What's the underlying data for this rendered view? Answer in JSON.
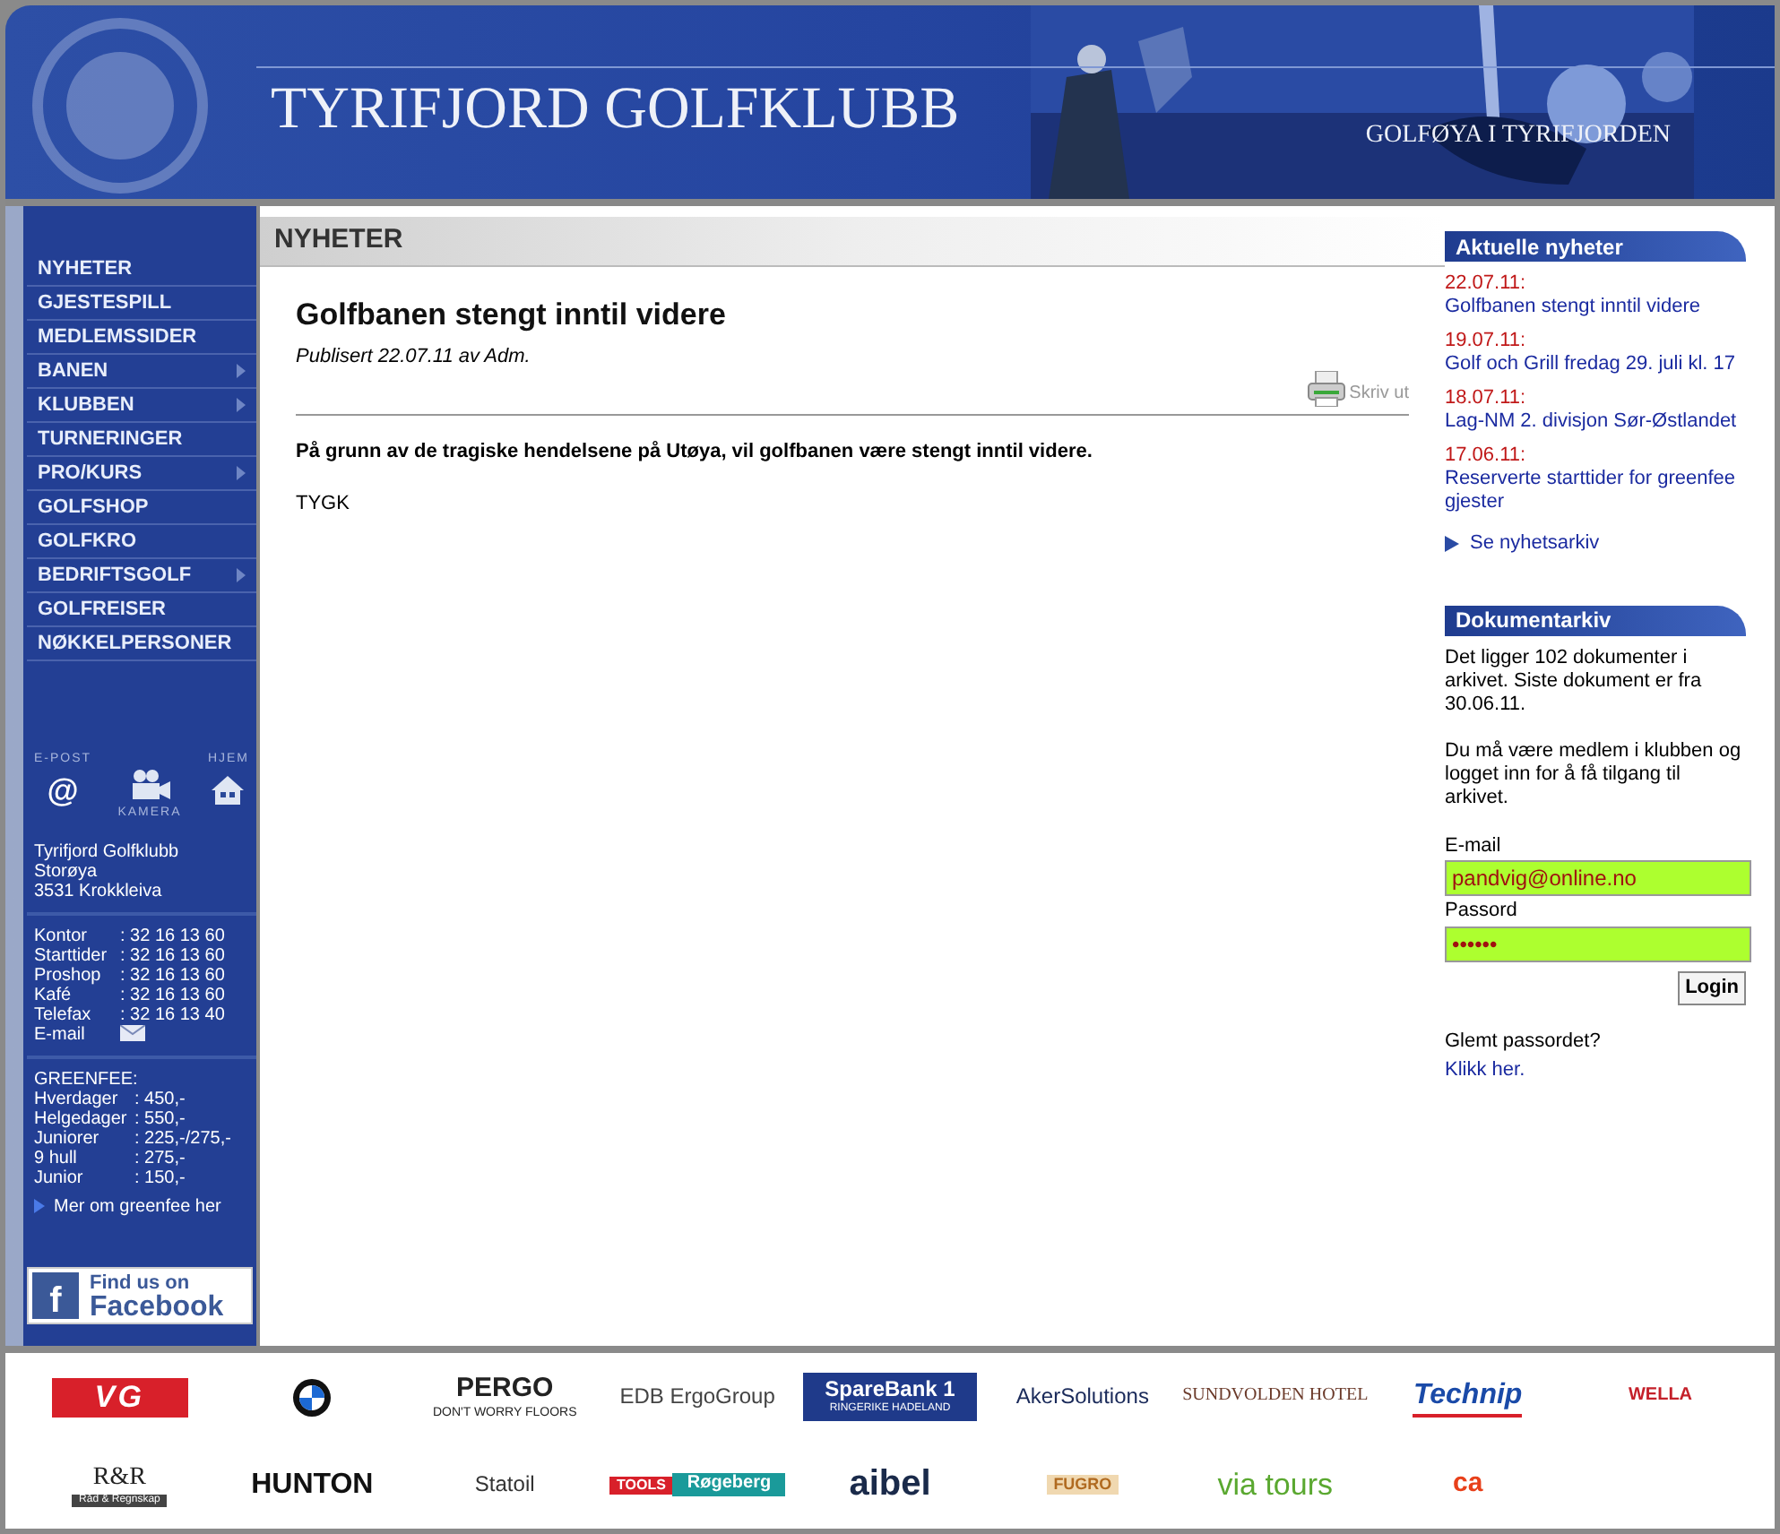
{
  "header": {
    "title": "TYRIFJORD GOLFKLUBB",
    "tagline": "GOLFØYA I TYRIFJORDEN"
  },
  "menu": [
    {
      "label": "NYHETER",
      "has_submenu": false
    },
    {
      "label": "GJESTESPILL",
      "has_submenu": false
    },
    {
      "label": "MEDLEMSSIDER",
      "has_submenu": false
    },
    {
      "label": "BANEN",
      "has_submenu": true
    },
    {
      "label": "KLUBBEN",
      "has_submenu": true
    },
    {
      "label": "TURNERINGER",
      "has_submenu": false
    },
    {
      "label": "PRO/KURS",
      "has_submenu": true
    },
    {
      "label": "GOLFSHOP",
      "has_submenu": false
    },
    {
      "label": "GOLFKRO",
      "has_submenu": false
    },
    {
      "label": "BEDRIFTSGOLF",
      "has_submenu": true
    },
    {
      "label": "GOLFREISER",
      "has_submenu": false
    },
    {
      "label": "NØKKELPERSONER",
      "has_submenu": false
    }
  ],
  "quick_links": [
    {
      "kind": "email",
      "label": "E-POST",
      "glyph": "@"
    },
    {
      "kind": "camera",
      "label": "KAMERA"
    },
    {
      "kind": "home",
      "label": "HJEM"
    }
  ],
  "address": [
    "Tyrifjord Golfklubb",
    "Storøya",
    "3531 Krokkleiva"
  ],
  "contacts": [
    {
      "kind": "phone",
      "label": "Kontor",
      "value": ": 32 16 13 60"
    },
    {
      "kind": "phone",
      "label": "Starttider",
      "value": ": 32 16 13 60"
    },
    {
      "kind": "phone",
      "label": "Proshop",
      "value": ": 32 16 13 60"
    },
    {
      "kind": "phone",
      "label": "Kafé",
      "value": ": 32 16 13 60"
    },
    {
      "kind": "phone",
      "label": "Telefax",
      "value": ": 32 16 13 40"
    },
    {
      "kind": "email",
      "label": "E-mail"
    }
  ],
  "greenfee": {
    "title": "GREENFEE:",
    "rows": [
      {
        "label": "Hverdager",
        "value": ": 450,-"
      },
      {
        "label": "Helgedager",
        "value": ": 550,-"
      },
      {
        "label": "Juniorer",
        "value": ": 225,-/275,-"
      },
      {
        "label": "9 hull",
        "value": ": 275,-"
      },
      {
        "label": "Junior",
        "value": ": 150,-"
      }
    ],
    "link": "Mer om greenfee her"
  },
  "facebook": {
    "letter": "f",
    "line1": "Find us on",
    "line2": "Facebook"
  },
  "section_title": "NYHETER",
  "article": {
    "title": "Golfbanen stengt inntil videre",
    "byline": "Publisert 22.07.11 av Adm.",
    "print": "Skriv ut",
    "lead": "På grunn av de tragiske hendelsene på Utøya, vil golfbanen være stengt inntil videre.",
    "signature": "TYGK"
  },
  "news": {
    "title": "Aktuelle nyheter",
    "items": [
      {
        "date": "22.07.11:",
        "title": "Golfbanen stengt inntil videre"
      },
      {
        "date": "19.07.11:",
        "title": "Golf och Grill fredag 29. juli kl. 17"
      },
      {
        "date": "18.07.11:",
        "title": "Lag-NM 2. divisjon Sør-Østlandet"
      },
      {
        "date": "17.06.11:",
        "title": "Reserverte starttider for greenfee gjester"
      }
    ],
    "archive_link": "Se nyhetsarkiv"
  },
  "documents": {
    "title": "Dokumentarkiv",
    "text1": "Det ligger 102 dokumenter i arkivet. Siste dokument er fra 30.06.11.",
    "text2": "Du må være medlem i klubben og logget inn for å få tilgang til arkivet.",
    "email_label": "E-mail",
    "email_value": "pandvig@online.no",
    "password_label": "Passord",
    "password_value": "••••••",
    "login": "Login",
    "forgot": "Glemt passordet?",
    "forgot_link": "Klikk her."
  },
  "sponsors": [
    {
      "kind": "vg",
      "name": "VG"
    },
    {
      "kind": "bmw"
    },
    {
      "kind": "pergo",
      "name": "PERGO",
      "sub": "DON'T WORRY FLOORS"
    },
    {
      "kind": "edb",
      "name": "EDB ErgoGroup"
    },
    {
      "kind": "sparebank",
      "name": "SpareBank 1",
      "sub": "RINGERIKE HADELAND"
    },
    {
      "kind": "aker",
      "name": "AkerSolutions"
    },
    {
      "kind": "sundvolden",
      "name": "SUNDVOLDEN HOTEL"
    },
    {
      "kind": "technip",
      "name": "Technip"
    },
    {
      "kind": "wella",
      "name": "WELLA"
    },
    {
      "kind": "rr",
      "name": "R&R",
      "sub": "Råd & Regnskap"
    },
    {
      "kind": "hunton",
      "name": "HUNTON"
    },
    {
      "kind": "statoil",
      "name": "Statoil"
    },
    {
      "kind": "rogeberg",
      "name": "TOOLS",
      "sub": "Røgeberg"
    },
    {
      "kind": "aibel",
      "name": "aibel"
    },
    {
      "kind": "fugro",
      "name": "FUGRO"
    },
    {
      "kind": "via",
      "name": "via tours"
    },
    {
      "kind": "ca",
      "name": "ca"
    }
  ]
}
